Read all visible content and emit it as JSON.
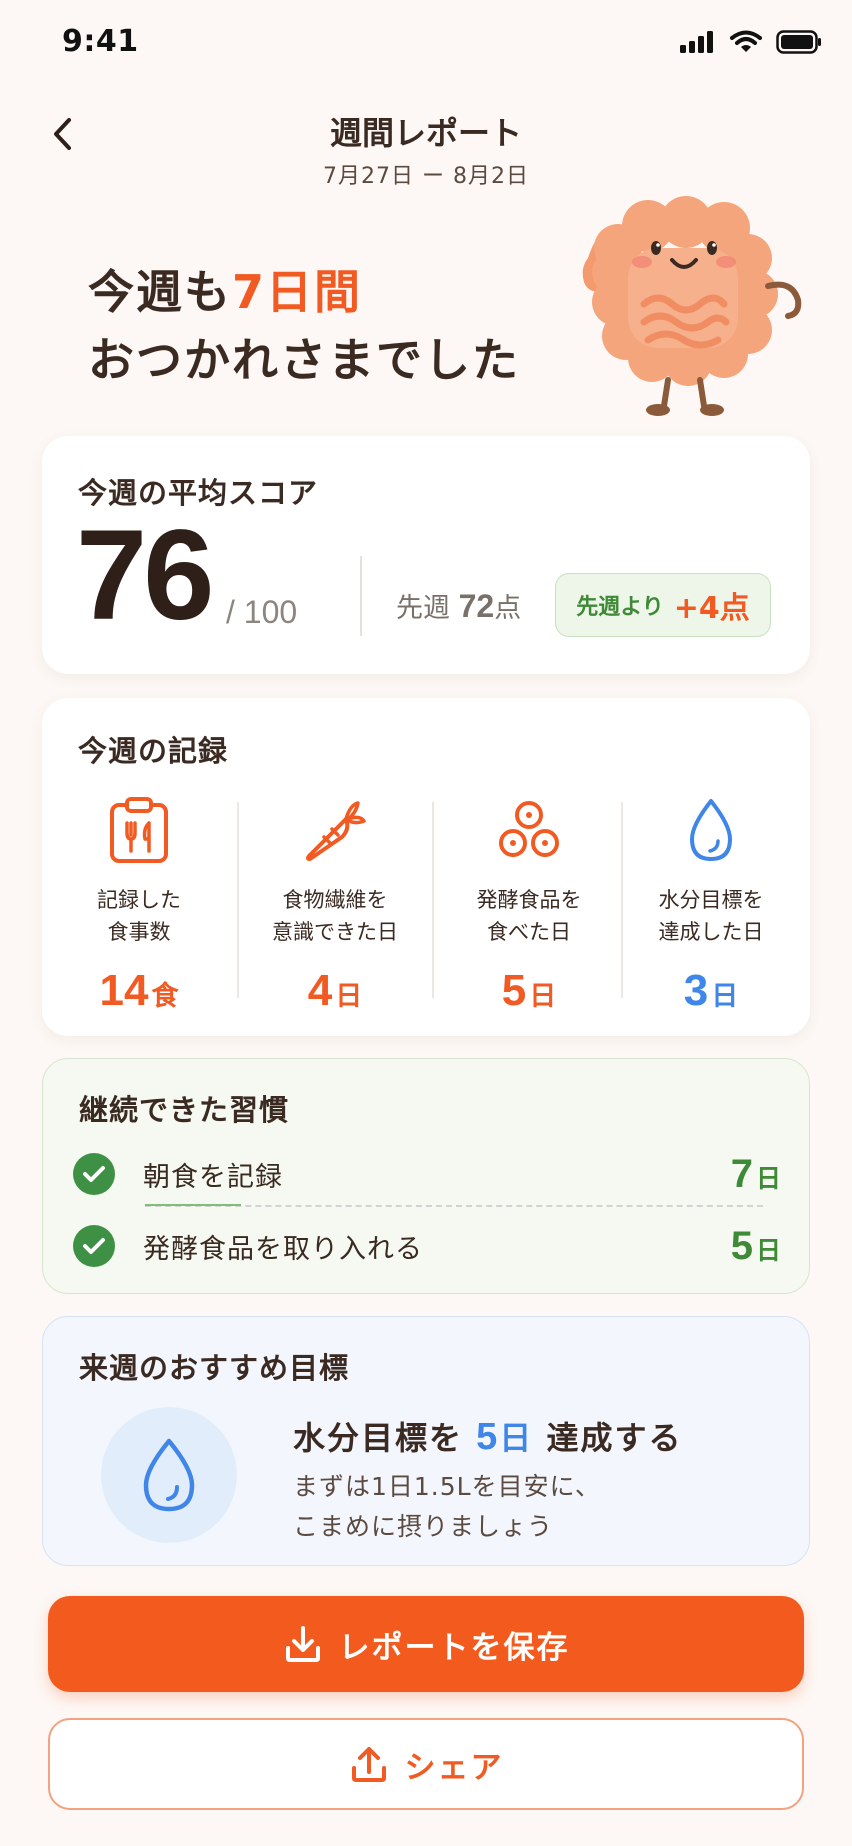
{
  "status_bar": {
    "time": "9:41"
  },
  "header": {
    "title": "週間レポート",
    "date_range": "7月27日 ー 8月2日"
  },
  "hero": {
    "line1_prefix": "今週も",
    "line1_accent": "7日間",
    "line2": "おつかれさまでした"
  },
  "score": {
    "title": "今週の平均スコア",
    "value": "76",
    "max": "/ 100",
    "prev_label": "先週",
    "prev_value": "72",
    "prev_unit": "点",
    "diff_label": "先週より",
    "diff_value": "+4点"
  },
  "records": {
    "title": "今週の記録",
    "items": [
      {
        "icon": "clipboard-utensils-icon",
        "line1": "記録した",
        "line2": "食事数",
        "value": "14",
        "unit": "食",
        "color": "#F15A22"
      },
      {
        "icon": "carrot-icon",
        "line1": "食物繊維を",
        "line2": "意識できた日",
        "value": "4",
        "unit": "日",
        "color": "#F15A22"
      },
      {
        "icon": "fermented-beans-icon",
        "line1": "発酵食品を",
        "line2": "食べた日",
        "value": "5",
        "unit": "日",
        "color": "#F15A22"
      },
      {
        "icon": "water-drop-icon",
        "line1": "水分目標を",
        "line2": "達成した日",
        "value": "3",
        "unit": "日",
        "color": "#3F86E8"
      }
    ]
  },
  "habits": {
    "title": "継続できた習慣",
    "items": [
      {
        "label": "朝食を記録",
        "days": "7",
        "unit": "日"
      },
      {
        "label": "発酵食品を取り入れる",
        "days": "5",
        "unit": "日"
      }
    ]
  },
  "goal": {
    "title": "来週のおすすめ目標",
    "headline_prefix": "水分目標を",
    "headline_num": "5",
    "headline_unit": "日",
    "headline_suffix": "達成する",
    "desc_line1": "まずは1日1.5Lを目安に、",
    "desc_line2": "こまめに摂りましょう"
  },
  "actions": {
    "save_label": "レポートを保存",
    "share_label": "シェア"
  },
  "colors": {
    "accent": "#F15A22",
    "green": "#3E8A36",
    "blue": "#3F86E8",
    "background": "#FDF8F5"
  }
}
